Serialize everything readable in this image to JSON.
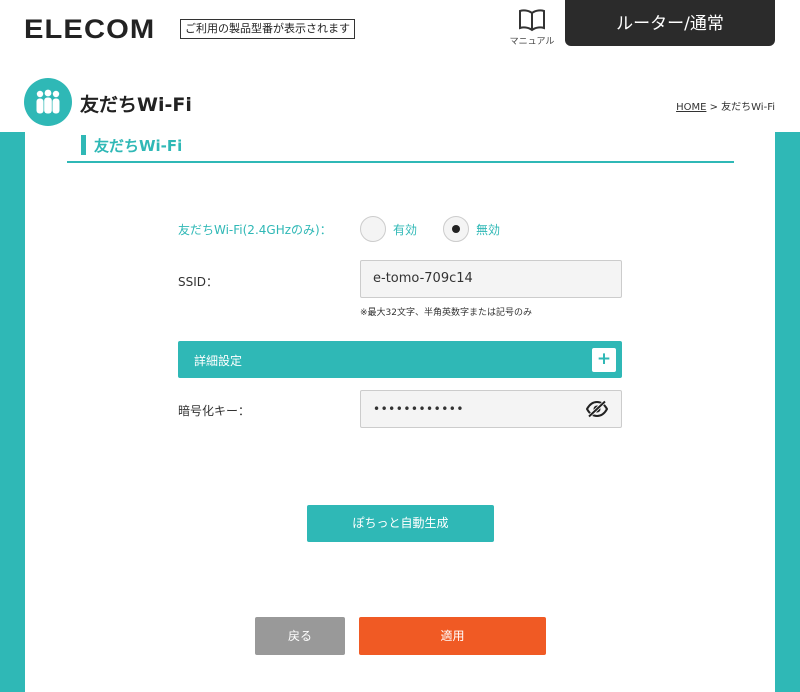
{
  "header": {
    "logo": "ELECOM",
    "tagline": "ご利用の製品型番が表示されます",
    "manual_label": "マニュアル",
    "mode": "ルーター/通常"
  },
  "page": {
    "title": "友だちWi-Fi",
    "breadcrumb_home": "HOME",
    "breadcrumb_current": " > 友だちWi-Fi"
  },
  "section": {
    "title": "友だちWi-Fi"
  },
  "form": {
    "friend_wifi_label": "友だちWi-Fi(2.4GHzのみ)：",
    "options": [
      {
        "label": "有効",
        "checked": false
      },
      {
        "label": "無効",
        "checked": true
      }
    ],
    "ssid_label": "SSID：",
    "ssid_value": "e-tomo-709c14",
    "ssid_hint": "※最大32文字、半角英数字または記号のみ",
    "advanced_label": "詳細設定",
    "advanced_toggle": "+",
    "key_label": "暗号化キー：",
    "key_value": "••••••••••••"
  },
  "buttons": {
    "generate": "ぽちっと自動生成",
    "back": "戻る",
    "apply": "適用"
  },
  "icons": {
    "manual": "book-icon",
    "title": "people-icon",
    "visibility": "eye-off-icon"
  },
  "colors": {
    "accent": "#2fb8b6",
    "apply": "#f05a24",
    "back": "#999999",
    "mode_bg": "#2b2b2b"
  }
}
